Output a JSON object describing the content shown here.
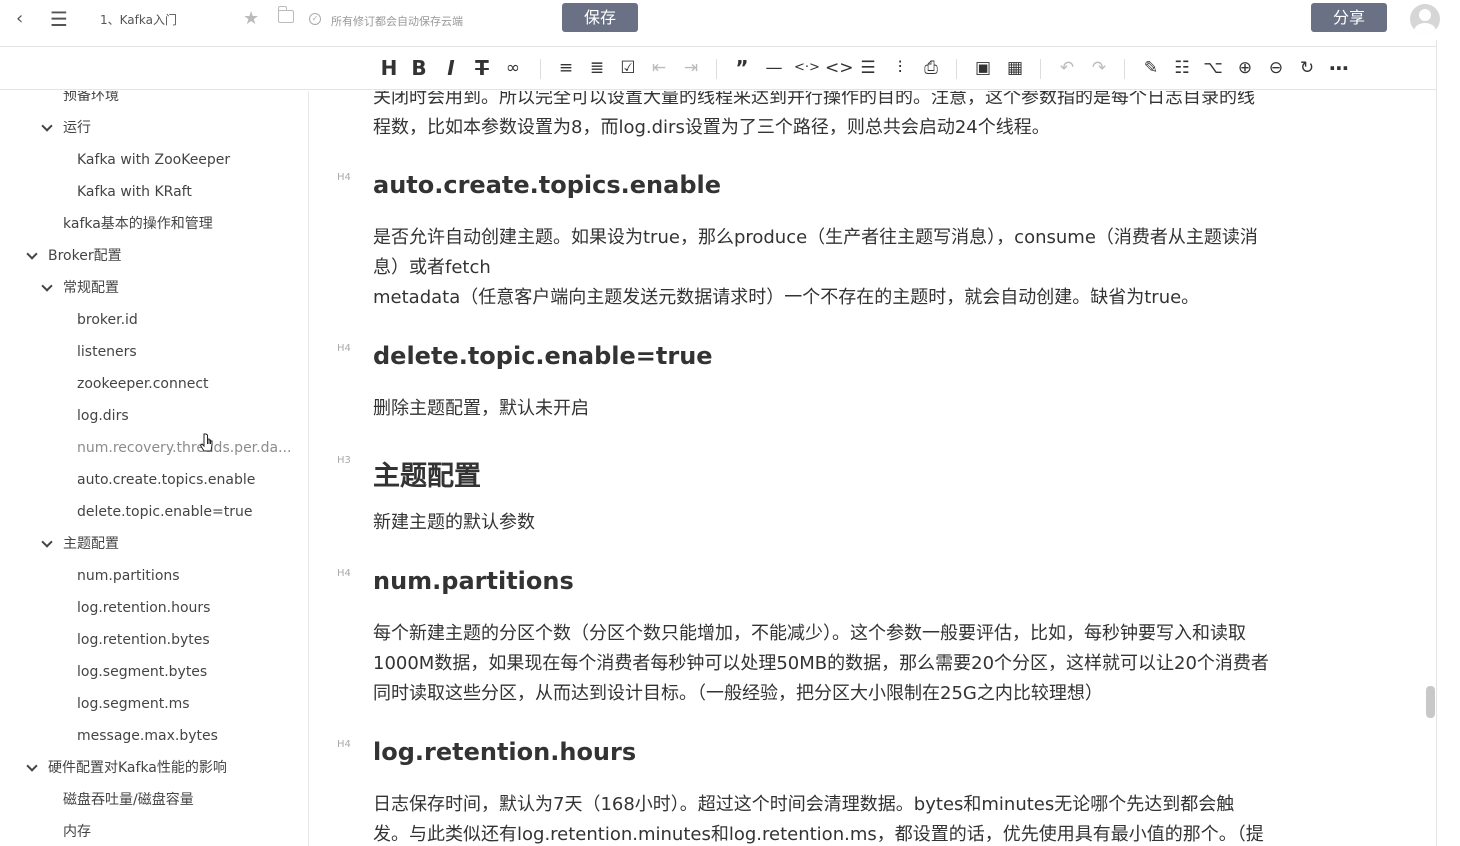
{
  "topbar": {
    "back_icon": "chevron-left-icon",
    "menu_icon": "hamburger-icon",
    "doc_title": "1、Kafka入门",
    "saved_status": "所有修订都会自动保存云端",
    "save_label": "保存",
    "share_label": "分享"
  },
  "toolbar": {
    "groups": [
      [
        "heading",
        "bold",
        "italic",
        "strikethrough",
        "link"
      ],
      [
        "bullet-list",
        "numbered-list",
        "checklist",
        "outdent",
        "indent"
      ],
      [
        "quote",
        "horizontal-rule",
        "inline-code",
        "code-block",
        "align",
        "clear-format",
        "attachment"
      ],
      [
        "image",
        "table"
      ],
      [
        "undo",
        "redo"
      ],
      [
        "edit",
        "note",
        "mindmap",
        "zoom-in",
        "zoom-out",
        "refresh",
        "more"
      ]
    ]
  },
  "sidebar": {
    "items": [
      {
        "label": "预备环境",
        "level": 2,
        "chevron": false
      },
      {
        "label": "运行",
        "level": 2,
        "chevron": true
      },
      {
        "label": "Kafka with ZooKeeper",
        "level": 3,
        "chevron": false
      },
      {
        "label": "Kafka with KRaft",
        "level": 3,
        "chevron": false
      },
      {
        "label": "kafka基本的操作和管理",
        "level": 2,
        "chevron": false
      },
      {
        "label": "Broker配置",
        "level": 1,
        "chevron": true
      },
      {
        "label": "常规配置",
        "level": 2,
        "chevron": true
      },
      {
        "label": "broker.id",
        "level": 3,
        "chevron": false
      },
      {
        "label": "listeners",
        "level": 3,
        "chevron": false
      },
      {
        "label": "zookeeper.connect",
        "level": 3,
        "chevron": false
      },
      {
        "label": "log.dirs",
        "level": 3,
        "chevron": false
      },
      {
        "label": "num.recovery.threads.per.da...",
        "level": 3,
        "chevron": false,
        "dim": true
      },
      {
        "label": "auto.create.topics.enable",
        "level": 3,
        "chevron": false
      },
      {
        "label": "delete.topic.enable=true",
        "level": 3,
        "chevron": false
      },
      {
        "label": "主题配置",
        "level": 2,
        "chevron": true
      },
      {
        "label": "num.partitions",
        "level": 3,
        "chevron": false
      },
      {
        "label": "log.retention.hours",
        "level": 3,
        "chevron": false
      },
      {
        "label": "log.retention.bytes",
        "level": 3,
        "chevron": false
      },
      {
        "label": "log.segment.bytes",
        "level": 3,
        "chevron": false
      },
      {
        "label": "log.segment.ms",
        "level": 3,
        "chevron": false
      },
      {
        "label": "message.max.bytes",
        "level": 3,
        "chevron": false
      },
      {
        "label": "硬件配置对Kafka性能的影响",
        "level": 1,
        "chevron": true
      },
      {
        "label": "磁盘吞吐量/磁盘容量",
        "level": 2,
        "chevron": false
      },
      {
        "label": "内存",
        "level": 2,
        "chevron": false
      }
    ]
  },
  "content": {
    "top_para": [
      "关闭时会用到。所以完全可以设置大量的线程来达到并行操作的目的。注意，这个参数指的是每个日志目录的线",
      "程数，比如本参数设置为8，而log.dirs设置为了三个路径，则总共会启动24个线程。"
    ],
    "sections": [
      {
        "level": "H4",
        "title": "auto.create.topics.enable",
        "lines": [
          "是否允许自动创建主题。如果设为true，那么produce（生产者往主题写消息），consume（消费者从主题读消",
          "息）或者fetch",
          "metadata（任意客户端向主题发送元数据请求时）一个不存在的主题时，就会自动创建。缺省为true。"
        ]
      },
      {
        "level": "H4",
        "title": "delete.topic.enable=true",
        "lines": [
          "删除主题配置，默认未开启"
        ]
      },
      {
        "level": "H3",
        "title": "主题配置",
        "lines": [
          "新建主题的默认参数"
        ]
      },
      {
        "level": "H4",
        "title": "num.partitions",
        "lines": [
          "每个新建主题的分区个数（分区个数只能增加，不能减少）。这个参数一般要评估，比如，每秒钟要写入和读取",
          "1000M数据，如果现在每个消费者每秒钟可以处理50MB的数据，那么需要20个分区，这样就可以让20个消费者",
          "同时读取这些分区，从而达到设计目标。（一般经验，把分区大小限制在25G之内比较理想）"
        ]
      },
      {
        "level": "H4",
        "title": "log.retention.hours",
        "lines": [
          "日志保存时间，默认为7天（168小时）。超过这个时间会清理数据。bytes和minutes无论哪个先达到都会触",
          "发。与此类似还有log.retention.minutes和log.retention.ms，都设置的话，优先使用具有最小值的那个。（提"
        ]
      }
    ]
  }
}
